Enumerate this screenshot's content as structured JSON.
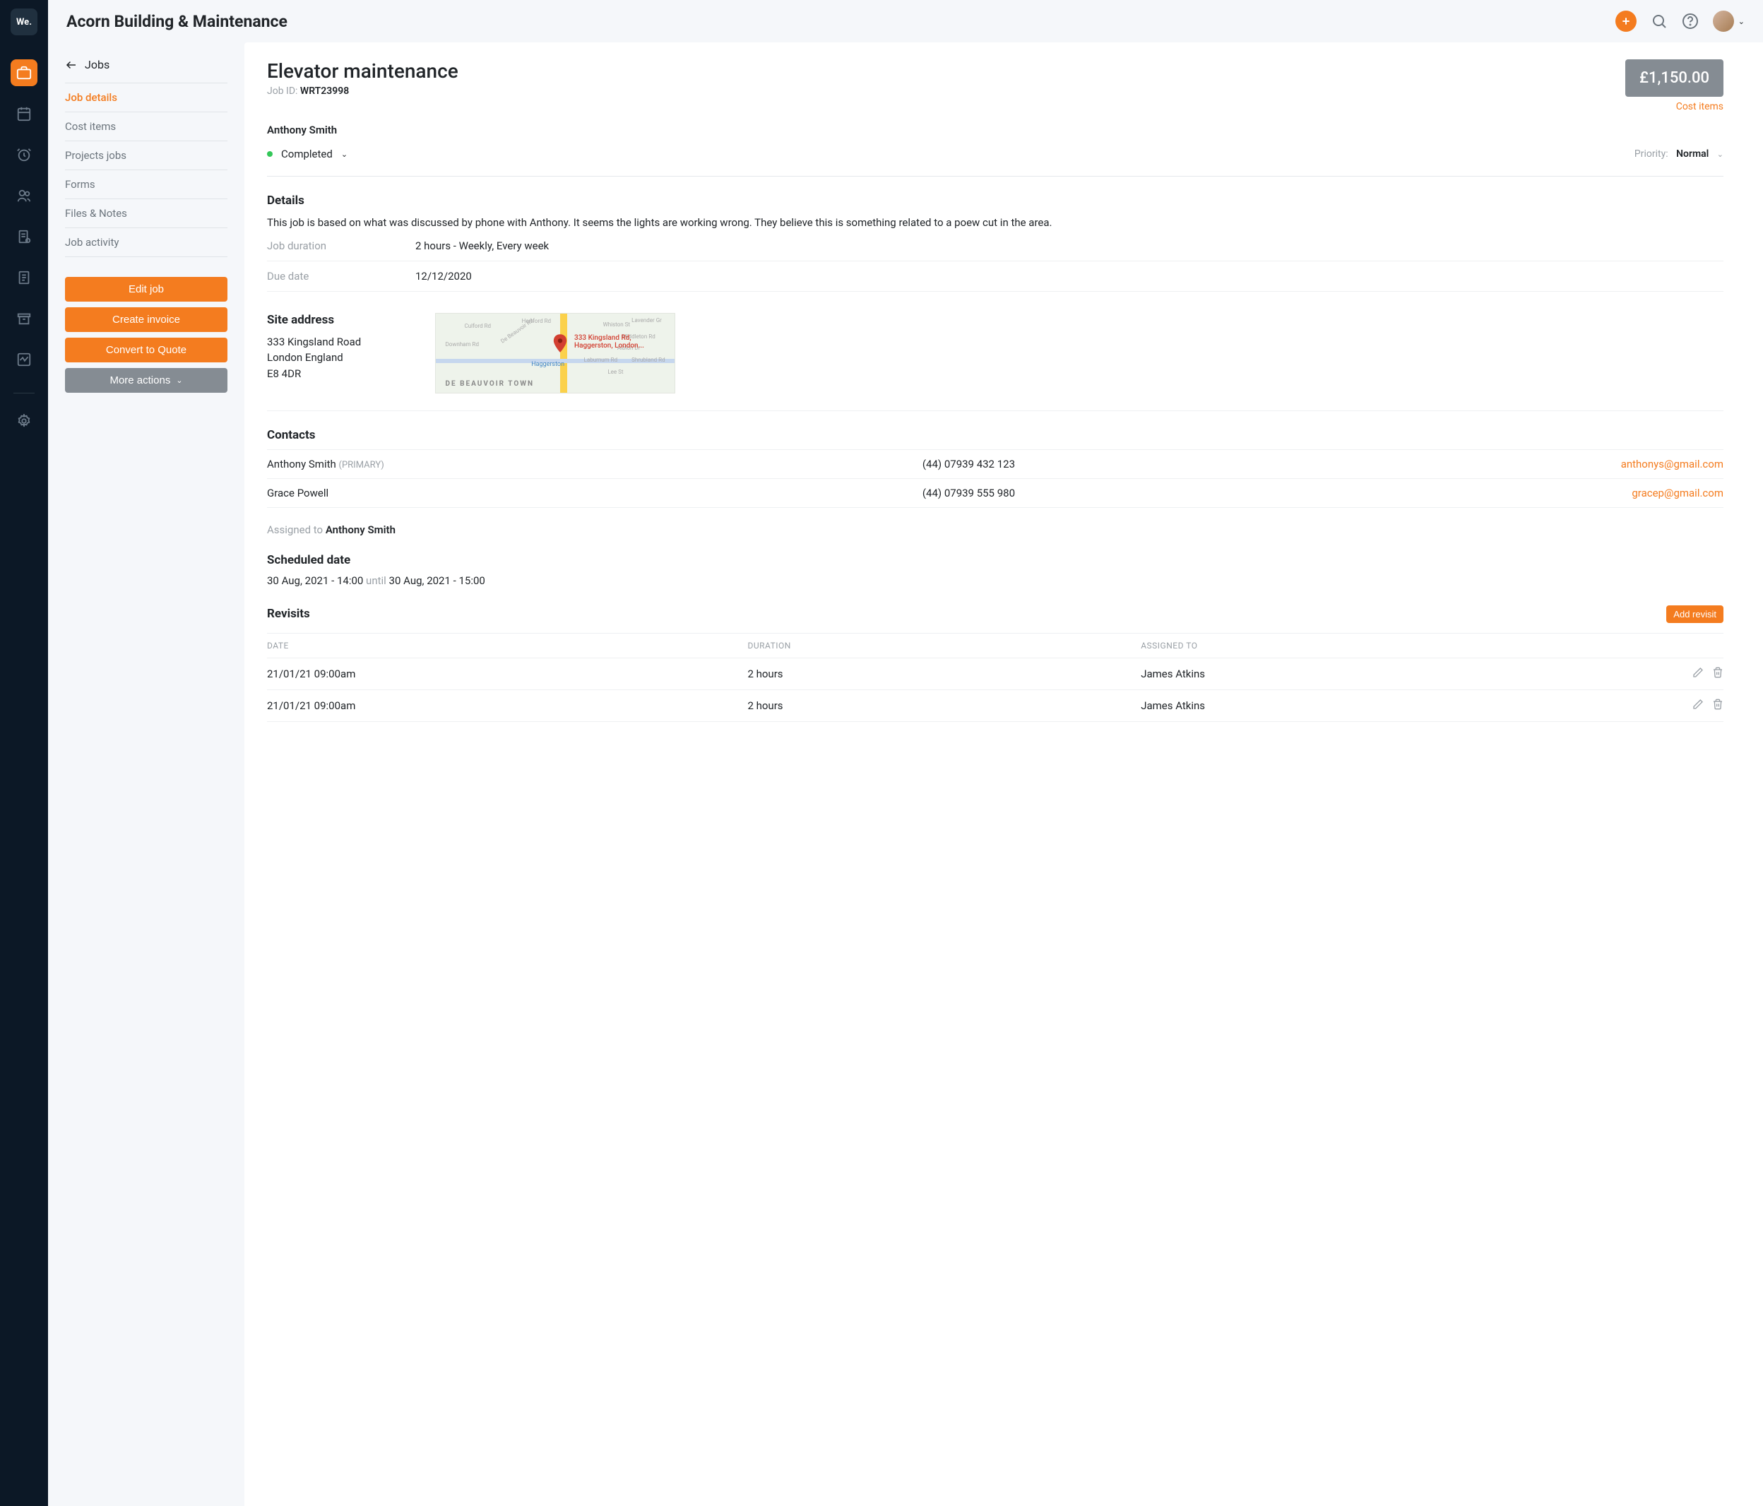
{
  "company": "Acorn Building & Maintenance",
  "rail_logo": "We.",
  "sidebar": {
    "back_label": "Jobs",
    "nav": [
      {
        "label": "Job details",
        "active": true
      },
      {
        "label": "Cost items"
      },
      {
        "label": "Projects jobs"
      },
      {
        "label": "Forms"
      },
      {
        "label": "Files & Notes"
      },
      {
        "label": "Job activity"
      }
    ],
    "buttons": {
      "edit": "Edit job",
      "invoice": "Create invoice",
      "quote": "Convert to Quote",
      "more": "More actions"
    }
  },
  "job": {
    "title": "Elevator maintenance",
    "id_label": "Job ID:",
    "id": "WRT23998",
    "price": "£1,150.00",
    "cost_link": "Cost items",
    "customer": "Anthony Smith",
    "status": "Completed",
    "priority_label": "Priority:",
    "priority_value": "Normal",
    "details_heading": "Details",
    "details_text": "This job is based on what was discussed by phone with Anthony. It seems the lights are working wrong. They believe this is something related to a poew cut in the area.",
    "duration_label": "Job duration",
    "duration_value": "2 hours - Weekly, Every week",
    "due_label": "Due date",
    "due_value": "12/12/2020",
    "site_heading": "Site address",
    "address_line1": "333 Kingsland Road",
    "address_line2": "London England",
    "address_line3": "E8 4DR",
    "map_label_line1": "333 Kingsland Rd,",
    "map_label_line2": "Haggerston, London...",
    "map_area": "DE BEAUVOIR TOWN",
    "map_area2": "Haggerston",
    "contacts_heading": "Contacts",
    "contacts": [
      {
        "name": "Anthony Smith",
        "tag": "(PRIMARY)",
        "phone": "(44) 07939 432 123",
        "email": "anthonys@gmail.com"
      },
      {
        "name": "Grace Powell",
        "tag": "",
        "phone": "(44) 07939 555 980",
        "email": "gracep@gmail.com"
      }
    ],
    "assigned_label": "Assigned to",
    "assigned_value": "Anthony Smith",
    "scheduled_heading": "Scheduled date",
    "scheduled_start": "30 Aug, 2021 - 14:00",
    "scheduled_until": "until",
    "scheduled_end": "30 Aug, 2021 - 15:00",
    "revisits_heading": "Revisits",
    "add_revisit": "Add revisit",
    "rev_headers": {
      "date": "DATE",
      "duration": "DURATION",
      "assigned": "ASSIGNED TO"
    },
    "revisits": [
      {
        "date": "21/01/21 09:00am",
        "duration": "2 hours",
        "assigned": "James Atkins"
      },
      {
        "date": "21/01/21 09:00am",
        "duration": "2 hours",
        "assigned": "James Atkins"
      }
    ]
  }
}
